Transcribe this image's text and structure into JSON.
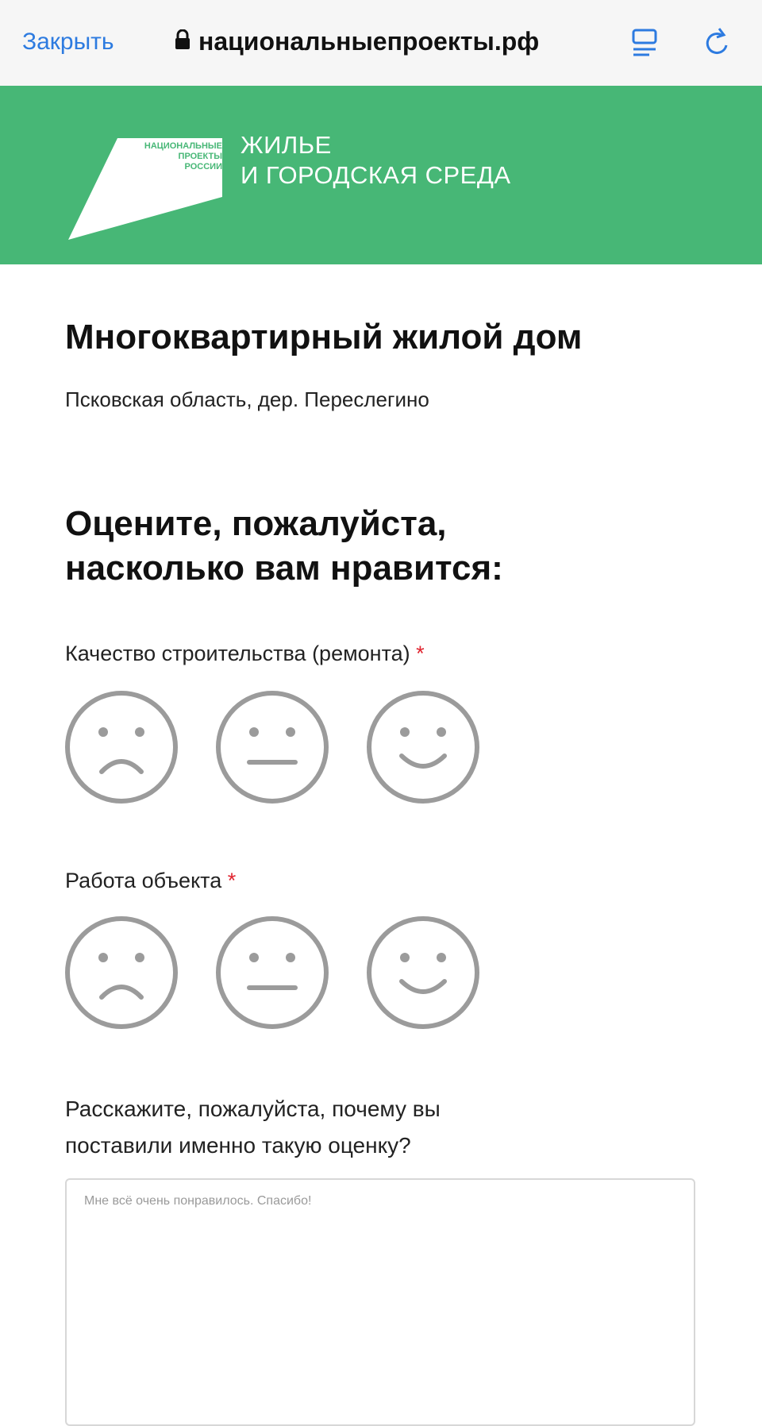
{
  "browser": {
    "close_label": "Закрыть",
    "url": "национальныепроекты.рф",
    "icons": [
      "lock-icon",
      "reader-icon",
      "reload-icon"
    ]
  },
  "banner": {
    "logo_tiny": [
      "НАЦИОНАЛЬНЫЕ",
      "ПРОЕКТЫ",
      "РОССИИ"
    ],
    "title_line1": "ЖИЛЬЕ",
    "title_line2": "И ГОРОДСКАЯ СРЕДА",
    "color": "#47b776"
  },
  "page": {
    "title": "Многоквартирный жилой дом",
    "address": "Псковская область, дер. Переслегино",
    "prompt_line1": "Оцените, пожалуйста,",
    "prompt_line2": "насколько вам нравится:"
  },
  "ratings": [
    {
      "label": "Качество строительства (ремонта)",
      "required_mark": "*",
      "options": [
        "sad-face-icon",
        "neutral-face-icon",
        "happy-face-icon"
      ]
    },
    {
      "label": "Работа объекта",
      "required_mark": "*",
      "options": [
        "sad-face-icon",
        "neutral-face-icon",
        "happy-face-icon"
      ]
    }
  ],
  "feedback": {
    "question_line1": "Расскажите, пожалуйста, почему вы",
    "question_line2": "поставили именно такую оценку?",
    "value": "Мне всё очень понравилось. Спасибо!"
  },
  "colors": {
    "accent": "#2d7be0",
    "required": "#e0242f",
    "icon_gray": "#9b9b9b"
  }
}
